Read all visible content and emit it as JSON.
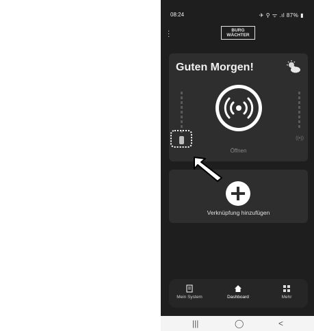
{
  "status_bar": {
    "time": "08:24",
    "left_icon": "location-icon",
    "right_icons": "✈ ⚲ ᯤ .ıl",
    "battery": "87%"
  },
  "header": {
    "logo_line1": "BURG",
    "logo_line2": "WÄCHTER"
  },
  "main_card": {
    "greeting": "Guten Morgen!",
    "weather_icon": "partly-cloudy-icon",
    "open_label": "Öffnen"
  },
  "add_card": {
    "label": "Verknüpfung hinzufügen"
  },
  "bottom_nav": {
    "items": [
      {
        "label": "Mein System",
        "icon": "system-icon"
      },
      {
        "label": "Dashboard",
        "icon": "home-icon"
      },
      {
        "label": "Mehr",
        "icon": "grid-icon"
      }
    ]
  },
  "system_nav": {
    "recents": "|||",
    "home": "◯",
    "back": "<"
  }
}
